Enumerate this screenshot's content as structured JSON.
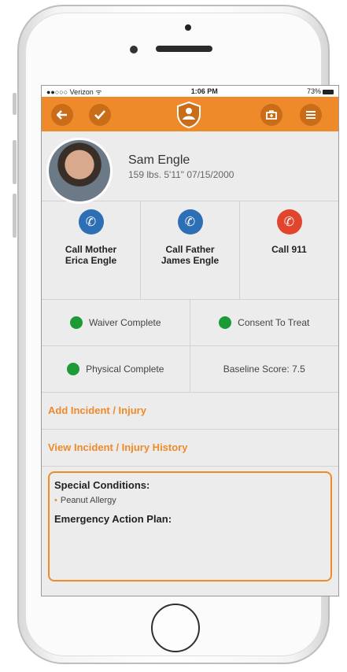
{
  "status_bar": {
    "carrier": "●●○○○ Verizon ᯤ",
    "time": "1:06 PM",
    "battery": "73%"
  },
  "app_bar": {
    "back_icon": "back-arrow-icon",
    "check_icon": "check-icon",
    "logo_icon": "shield-person-logo-icon",
    "firstaid_icon": "first-aid-kit-icon",
    "menu_icon": "menu-icon"
  },
  "profile": {
    "name": "Sam Engle",
    "details": "159 lbs. 5'11\" 07/15/2000"
  },
  "calls": [
    {
      "label": "Call Mother Erica Engle",
      "color": "#2d6fb5"
    },
    {
      "label": "Call Father James Engle",
      "color": "#2d6fb5"
    },
    {
      "label": "Call 911",
      "color": "#e2452d"
    }
  ],
  "statuses": [
    {
      "label": "Waiver Complete",
      "dot": true
    },
    {
      "label": "Consent To Treat",
      "dot": true
    },
    {
      "label": "Physical Complete",
      "dot": true
    },
    {
      "label": "Baseline Score: 7.5",
      "dot": false
    }
  ],
  "links": {
    "add": "Add Incident / Injury",
    "history": "View Incident / Injury History"
  },
  "conditions": {
    "title": "Special Conditions:",
    "items": [
      "Peanut Allergy"
    ],
    "plan_title": "Emergency Action Plan:"
  },
  "colors": {
    "accent": "#ef8a2a",
    "status_green": "#1b9a35",
    "call_blue": "#2d6fb5",
    "call_red": "#e2452d"
  }
}
